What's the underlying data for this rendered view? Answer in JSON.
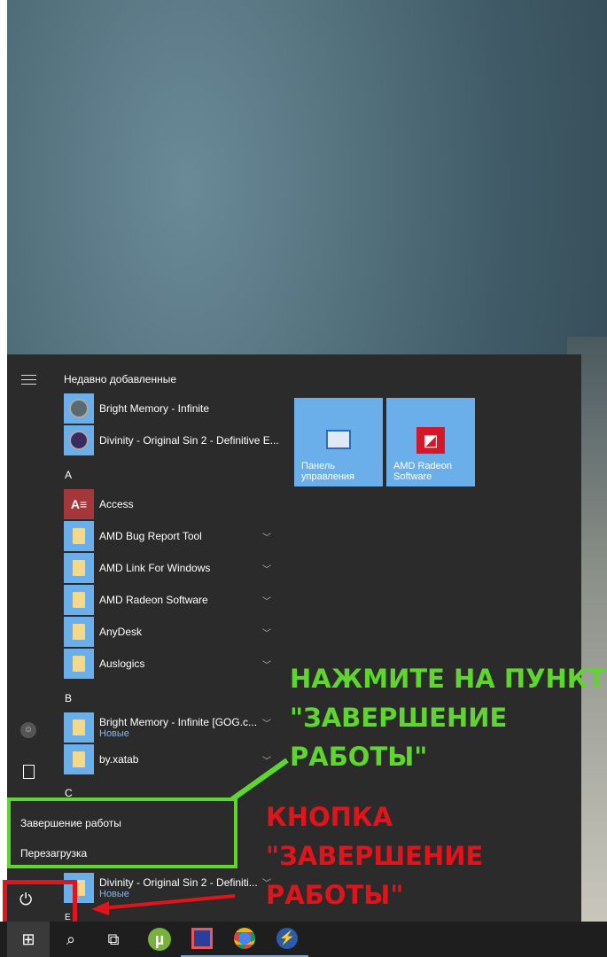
{
  "start_menu": {
    "recent_header": "Недавно добавленные",
    "recent": [
      {
        "label": "Bright Memory - Infinite"
      },
      {
        "label": "Divinity - Original Sin 2 - Definitive E..."
      }
    ],
    "letters": [
      "A",
      "B",
      "C",
      "E"
    ],
    "apps_a": [
      {
        "label": "Access",
        "icon": "access-icon"
      },
      {
        "label": "AMD Bug Report Tool"
      },
      {
        "label": "AMD Link For Windows"
      },
      {
        "label": "AMD Radeon Software"
      },
      {
        "label": "AnyDesk"
      },
      {
        "label": "Auslogics"
      }
    ],
    "apps_b": [
      {
        "label": "Bright Memory - Infinite [GOG.c...",
        "sub": "Новые"
      },
      {
        "label": "by.xatab"
      }
    ],
    "apps_d": {
      "label": "Divinity - Original Sin 2 - Definiti...",
      "sub": "Новые"
    },
    "tiles": [
      {
        "label": "Панель управления"
      },
      {
        "label": "AMD Radeon Software"
      }
    ],
    "access_glyph": "A",
    "power_menu": [
      {
        "label": "Завершение работы"
      },
      {
        "label": "Перезагрузка"
      }
    ]
  },
  "annotations": {
    "green": [
      "НАЖМИТЕ НА ПУНКТ",
      "\"ЗАВЕРШЕНИЕ",
      "РАБОТЫ\""
    ],
    "red": [
      "КНОПКА",
      "\"ЗАВЕРШЕНИЕ",
      "РАБОТЫ\""
    ],
    "green_color": "#5fd62c",
    "red_color": "#e0141a"
  },
  "taskbar": {
    "search_glyph": "⌕",
    "taskview_glyph": "⧉",
    "utorrent_glyph": "µ"
  }
}
